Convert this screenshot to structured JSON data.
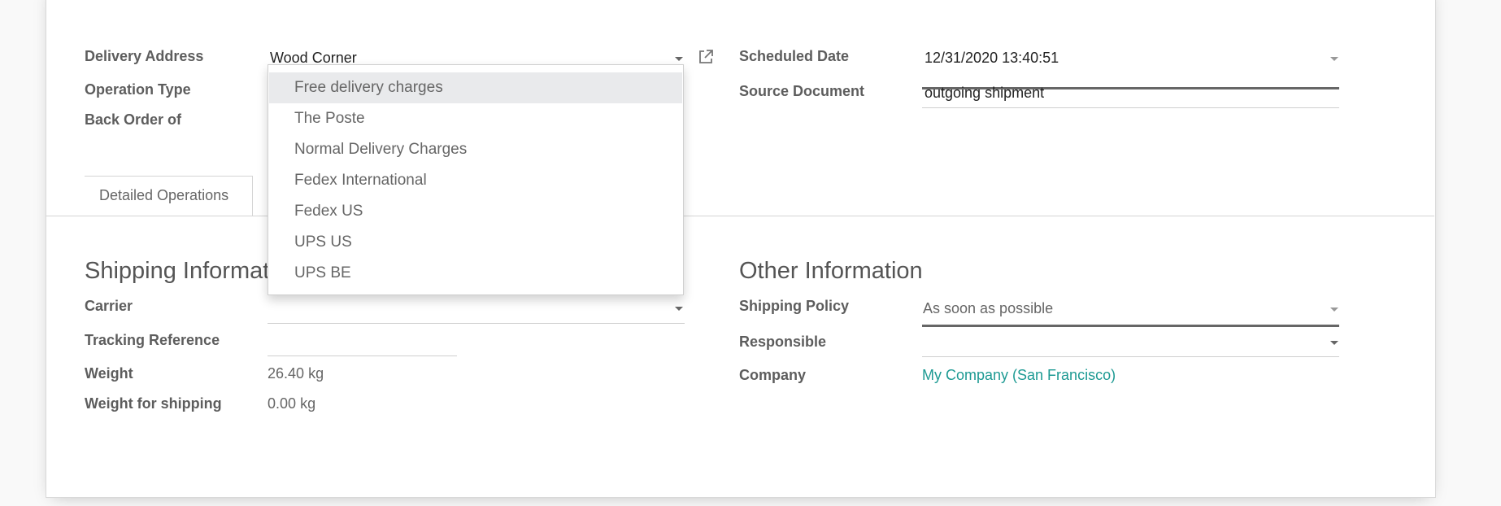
{
  "header": {
    "title_visible": ""
  },
  "main_fields_left": [
    {
      "label": "Delivery Address",
      "value": "Wood Corner"
    },
    {
      "label": "Operation Type",
      "value": ""
    },
    {
      "label": "Back Order of",
      "value": ""
    }
  ],
  "main_fields_right": [
    {
      "label": "Scheduled Date",
      "value": "12/31/2020 13:40:51"
    },
    {
      "label": "Source Document",
      "value": "outgoing shipment"
    }
  ],
  "icons": {
    "external_link": "external-link-icon",
    "dropdown_caret": "caret-down-icon"
  },
  "tabs": [
    {
      "label": "Detailed Operations",
      "active": false
    }
  ],
  "shipping_info": {
    "title": "Shipping Information",
    "fields": [
      {
        "label": "Carrier",
        "value": ""
      },
      {
        "label": "Tracking Reference",
        "value": ""
      },
      {
        "label": "Weight",
        "value": "26.40",
        "unit": "kg"
      },
      {
        "label": "Weight for shipping",
        "value": "0.00",
        "unit": "kg"
      }
    ]
  },
  "other_info": {
    "title": "Other Information",
    "fields": [
      {
        "label": "Shipping Policy",
        "value": "As soon as possible"
      },
      {
        "label": "Responsible",
        "value": ""
      },
      {
        "label": "Company",
        "value": "My Company (San Francisco)"
      }
    ]
  },
  "carrier_dropdown": {
    "highlighted_index": 0,
    "options": [
      "Free delivery charges",
      "The Poste",
      "Normal Delivery Charges",
      "Fedex International",
      "Fedex US",
      "UPS US",
      "UPS BE"
    ]
  },
  "colors": {
    "link": "#1d9a93",
    "focus_underline": "#666666",
    "highlight": "#e9eaec"
  }
}
